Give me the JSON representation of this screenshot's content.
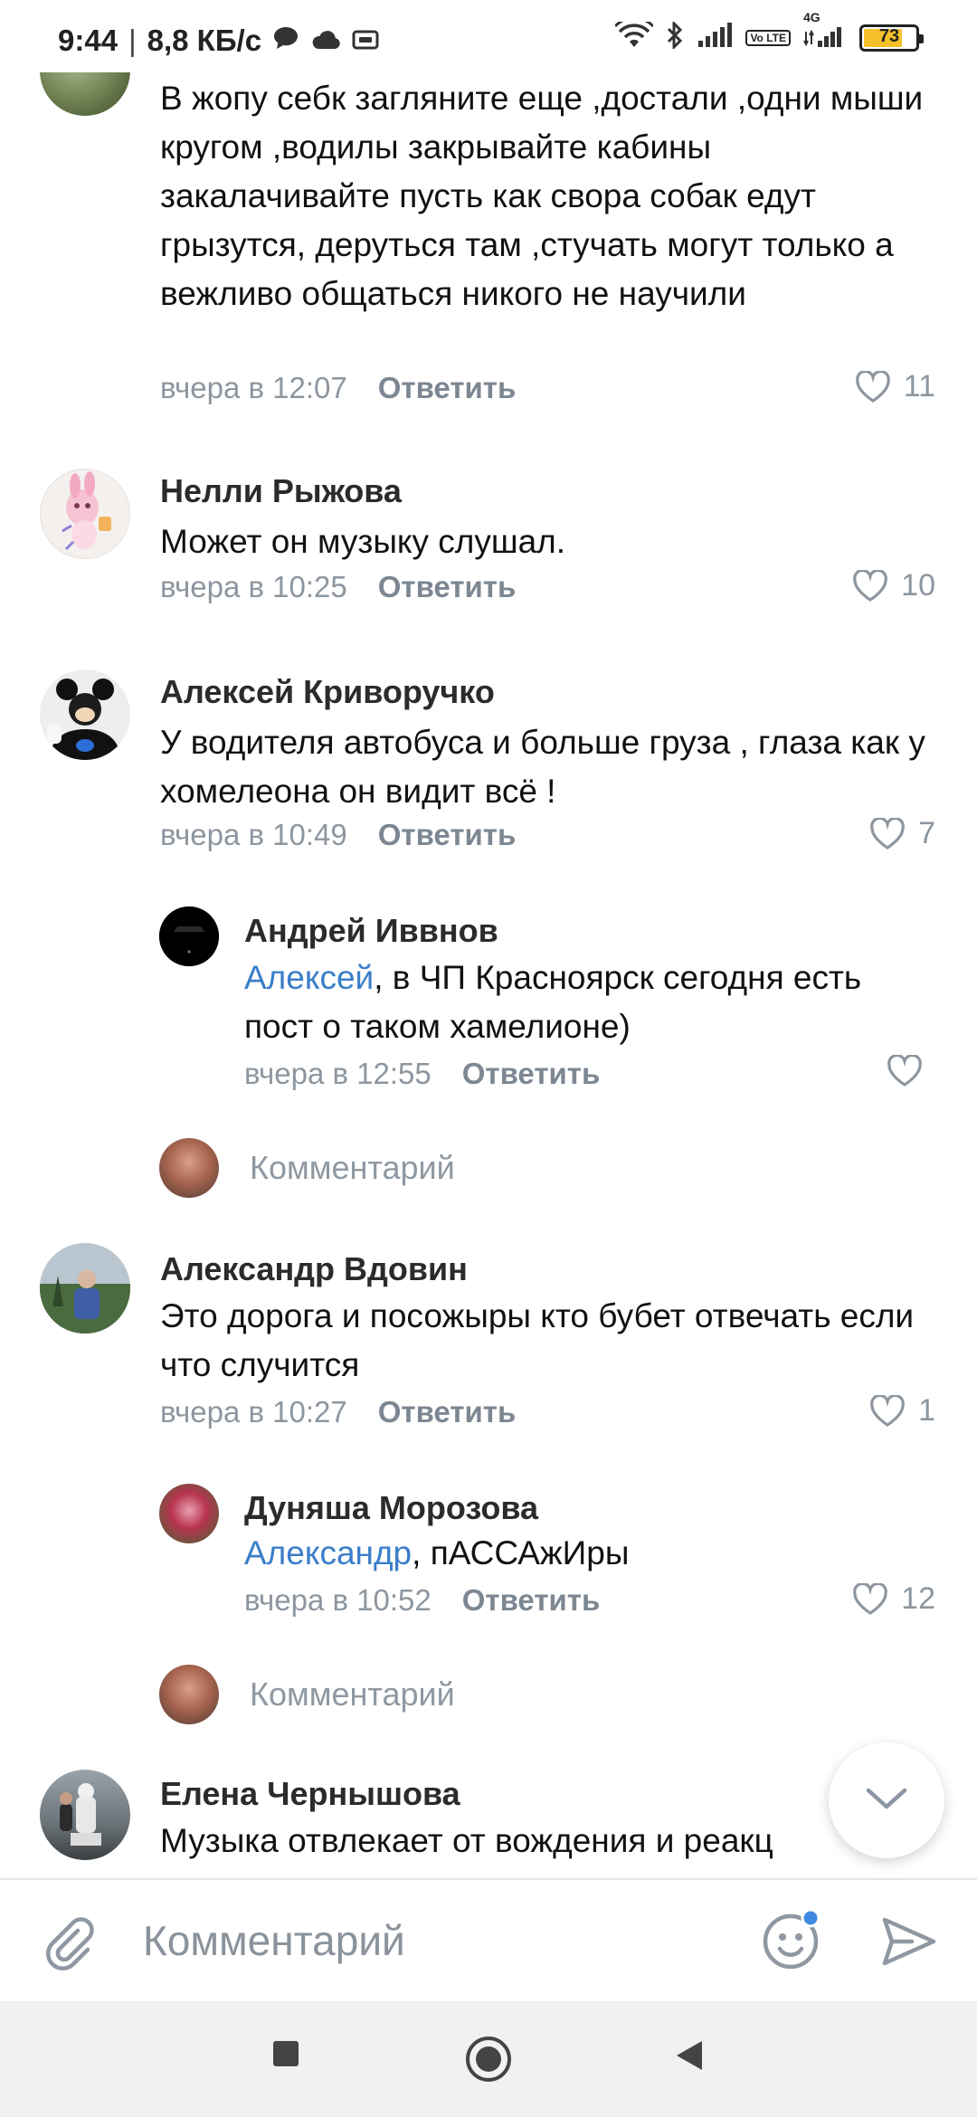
{
  "status_bar": {
    "time": "9:44",
    "speed": "8,8 КБ/с",
    "battery": "73",
    "network": "4G",
    "volte": "Vo LTE",
    "battery_level": 0.73,
    "icons": [
      "chat-icon",
      "cloud-icon",
      "box-icon",
      "wifi-icon",
      "bluetooth-icon",
      "signal-icon",
      "volte-icon",
      "signal-4g-icon",
      "battery-icon"
    ]
  },
  "comments": [
    {
      "author": "",
      "text": "В жопу себк загляните еще ,достали ,одни мыши кругом ,водилы закрывайте кабины закалачивайте пусть как свора собак едут грызутся, деруться там ,стучать могут только а вежливо общаться никого не научили",
      "time": "вчера в 12:07",
      "reply": "Ответить",
      "likes": "11"
    },
    {
      "author": "Нелли Рыжова",
      "text": "Может он музыку слушал.",
      "time": "вчера в 10:25",
      "reply": "Ответить",
      "likes": "10"
    },
    {
      "author": "Алексей Криворучко",
      "text": "У водителя автобуса и больше груза , глаза как у хомелеона он видит всё !",
      "time": "вчера в 10:49",
      "reply": "Ответить",
      "likes": "7",
      "replies": [
        {
          "author": "Андрей Иввнов",
          "mention": "Алексей",
          "text": ", в ЧП Красноярск сегодня есть пост о таком хамелионе)",
          "time": "вчера в 12:55",
          "reply": "Ответить",
          "likes": ""
        }
      ],
      "write_reply": "Комментарий"
    },
    {
      "author": "Александр Вдовин",
      "text": "Это дорога и посожыры кто бубет отвечать если что случится",
      "time": "вчера в 10:27",
      "reply": "Ответить",
      "likes": "1",
      "replies": [
        {
          "author": "Дуняша Морозова",
          "mention": "Александр",
          "text": ", пАССАжИры",
          "time": "вчера в 10:52",
          "reply": "Ответить",
          "likes": "12"
        }
      ],
      "write_reply": "Комментарий"
    },
    {
      "author": "Елена Чернышова",
      "text": "Музыка отвлекает от вождения и реакц"
    }
  ],
  "compose": {
    "placeholder": "Комментарий"
  },
  "colors": {
    "mention": "#3b7ec9",
    "meta": "#8d969f",
    "battery": "#f5c02a"
  }
}
